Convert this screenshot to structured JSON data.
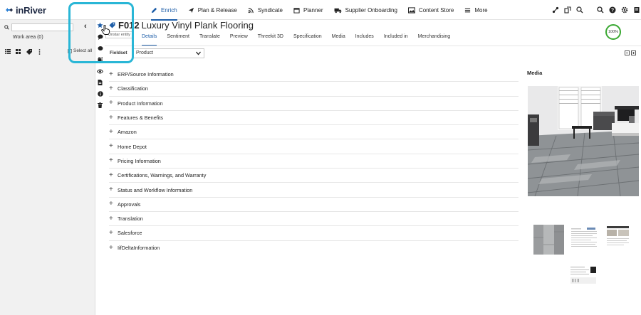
{
  "app": {
    "logo_text": "inRiver"
  },
  "nav": [
    {
      "label": "Enrich",
      "icon": "pencil-icon",
      "active": true
    },
    {
      "label": "Plan & Release",
      "icon": "paper-plane-icon"
    },
    {
      "label": "Syndicate",
      "icon": "broadcast-icon"
    },
    {
      "label": "Planner",
      "icon": "calendar-icon"
    },
    {
      "label": "Supplier Onboarding",
      "icon": "truck-icon"
    },
    {
      "label": "Content Store",
      "icon": "image-icon"
    },
    {
      "label": "More",
      "icon": "menu-icon"
    }
  ],
  "workarea": {
    "label": "Work area (0)",
    "select_all": "Select all"
  },
  "entity": {
    "id": "F012",
    "name": "Luxury Vinyl Plank Flooring",
    "tooltip": "Unstar entity",
    "completeness": "100%"
  },
  "tabs": [
    "Details",
    "Sentiment",
    "Translate",
    "Preview",
    "Threekit 3D",
    "Specification",
    "Media",
    "Includes",
    "Included in",
    "Merchandising"
  ],
  "fieldset": {
    "label": "Fieldset",
    "value": "Product"
  },
  "sections": [
    "ERP/Source Information",
    "Classification",
    "Product Information",
    "Features & Benefits",
    "Amazon",
    "Home Depot",
    "Pricing Information",
    "Certifications, Warnings, and Warranty",
    "Status and Workflow Information",
    "Approvals",
    "Translation",
    "Salesforce",
    "IifDeltaInformation"
  ],
  "media": {
    "label": "Media"
  },
  "colors": {
    "accent": "#1e5ea8",
    "highlight": "#29b6d6",
    "complete": "#3aa832"
  }
}
